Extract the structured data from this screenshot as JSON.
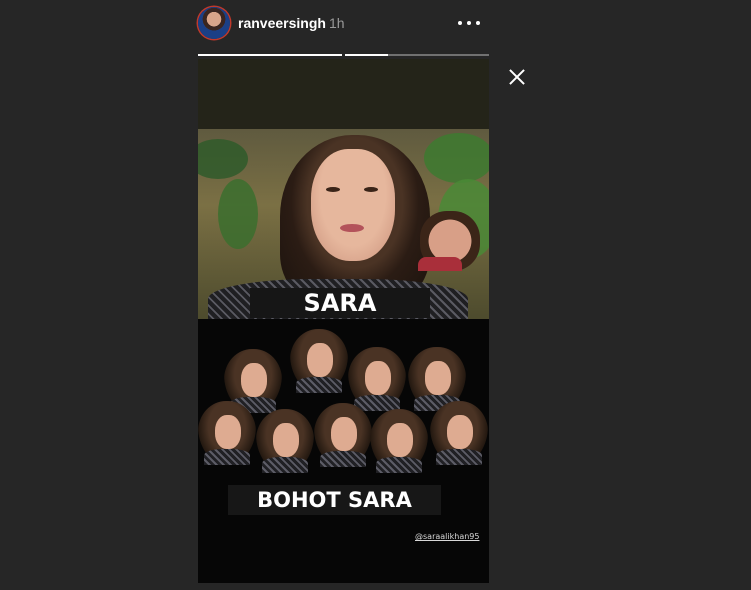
{
  "story_header": {
    "username": "ranveersingh",
    "timestamp": "1h",
    "more_icon": "more-horizontal-icon",
    "avatar_icon": "profile-avatar"
  },
  "progress": {
    "segments": [
      {
        "fill": 1.0
      },
      {
        "fill": 0.3
      }
    ]
  },
  "close_icon": "close-icon",
  "story": {
    "caption_top": "SARA",
    "caption_bottom": "BOHOT SARA",
    "handle": "@saraalikhan95"
  },
  "colors": {
    "background": "#262626",
    "avatar_ring": "#c0392b",
    "caption_bg": "#161616",
    "text": "#ffffff"
  }
}
